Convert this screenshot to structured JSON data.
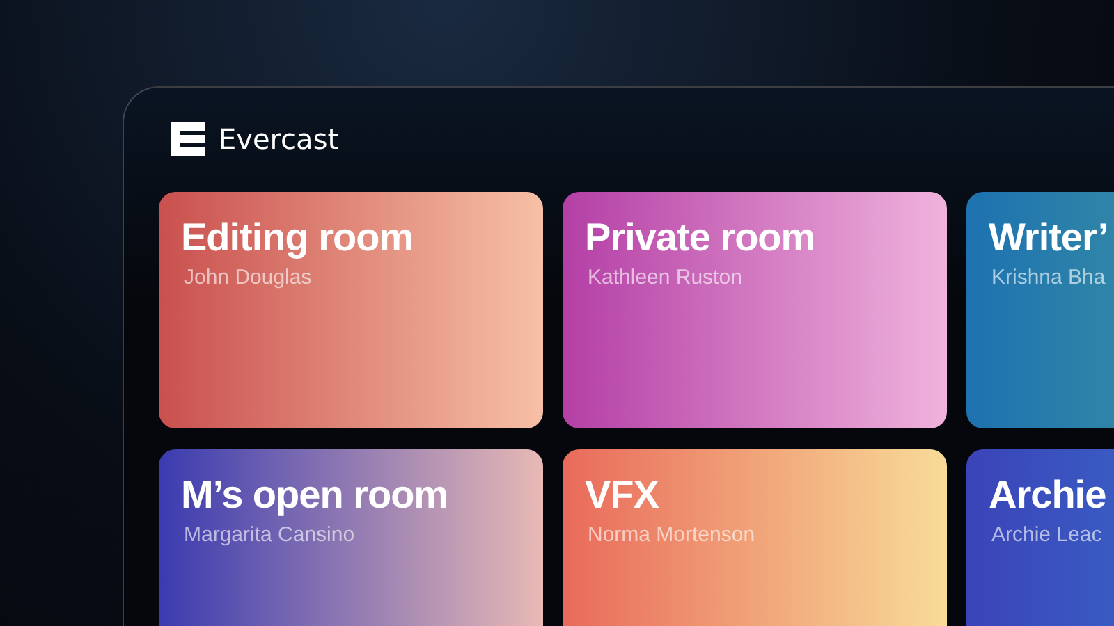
{
  "app": {
    "name": "Evercast"
  },
  "rooms": [
    {
      "title": "Editing room",
      "owner": "John Douglas",
      "color": "#c9504e"
    },
    {
      "title": "Private room",
      "owner": "Kathleen Ruston",
      "color": "#b43fa6"
    },
    {
      "title": "Writer’",
      "owner": "Krishna Bha",
      "color": "#1d72b0"
    },
    {
      "title": "M’s open room",
      "owner": "Margarita Cansino",
      "color": "#3a3bb0"
    },
    {
      "title": "VFX",
      "owner": "Norma Mortenson",
      "color": "#e96a5a"
    },
    {
      "title": "Archie",
      "owner": "Archie Leac",
      "color": "#3a44b8"
    }
  ]
}
